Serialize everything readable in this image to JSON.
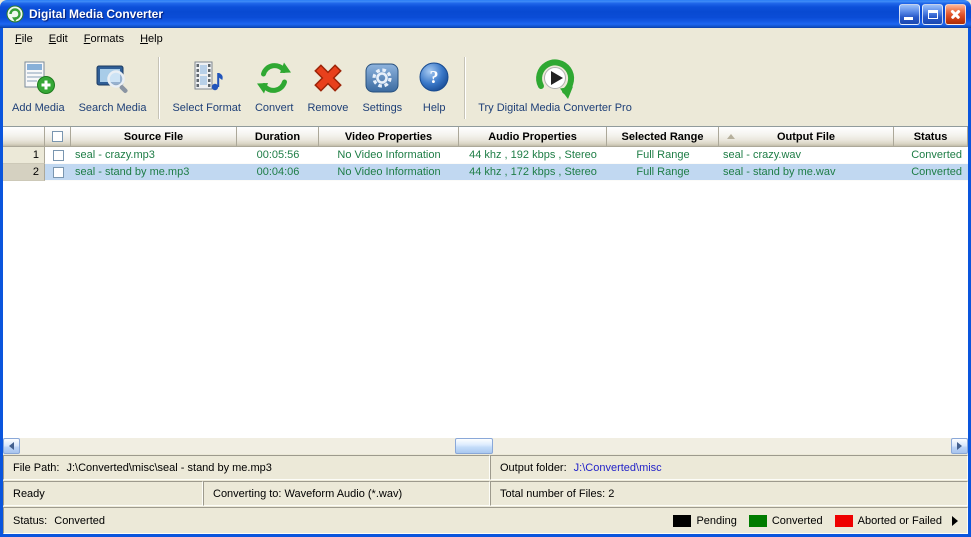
{
  "window": {
    "title": "Digital Media Converter"
  },
  "menu": {
    "items": [
      {
        "label": "File"
      },
      {
        "label": "Edit"
      },
      {
        "label": "Formats"
      },
      {
        "label": "Help"
      }
    ]
  },
  "toolbar": {
    "buttons": [
      {
        "label": "Add Media",
        "icon": "add-media-icon"
      },
      {
        "label": "Search Media",
        "icon": "search-media-icon"
      },
      {
        "label": "Select Format",
        "icon": "select-format-icon"
      },
      {
        "label": "Convert",
        "icon": "convert-icon"
      },
      {
        "label": "Remove",
        "icon": "remove-icon"
      },
      {
        "label": "Settings",
        "icon": "settings-icon"
      },
      {
        "label": "Help",
        "icon": "help-icon"
      },
      {
        "label": "Try Digital Media Converter Pro",
        "icon": "pro-play-icon"
      }
    ]
  },
  "table": {
    "headers": {
      "source": "Source File",
      "duration": "Duration",
      "video": "Video Properties",
      "audio": "Audio Properties",
      "range": "Selected Range",
      "output": "Output File",
      "status": "Status"
    },
    "rows": [
      {
        "num": "1",
        "source": "seal - crazy.mp3",
        "duration": "00:05:56",
        "video": "No Video Information",
        "audio": "44 khz , 192 kbps , Stereo",
        "range": "Full Range",
        "output": "seal - crazy.wav",
        "status": "Converted"
      },
      {
        "num": "2",
        "source": "seal - stand by me.mp3",
        "duration": "00:04:06",
        "video": "No Video Information",
        "audio": "44 khz , 172 kbps , Stereo",
        "range": "Full Range",
        "output": "seal - stand by me.wav",
        "status": "Converted"
      }
    ]
  },
  "statusbar": {
    "file_path_label": "File Path:",
    "file_path_value": "J:\\Converted\\misc\\seal - stand by me.mp3",
    "output_folder_label": "Output folder:",
    "output_folder_value": "J:\\Converted\\misc",
    "ready_text": "Ready",
    "converting_text": "Converting to: Waveform Audio (*.wav)",
    "total_files_text": "Total number of Files: 2",
    "status_label": "Status:",
    "status_value": "Converted",
    "legend": [
      {
        "label": "Pending",
        "color": "#000000"
      },
      {
        "label": "Converted",
        "color": "#007c00"
      },
      {
        "label": "Aborted or Failed",
        "color": "#ee0000"
      }
    ]
  }
}
